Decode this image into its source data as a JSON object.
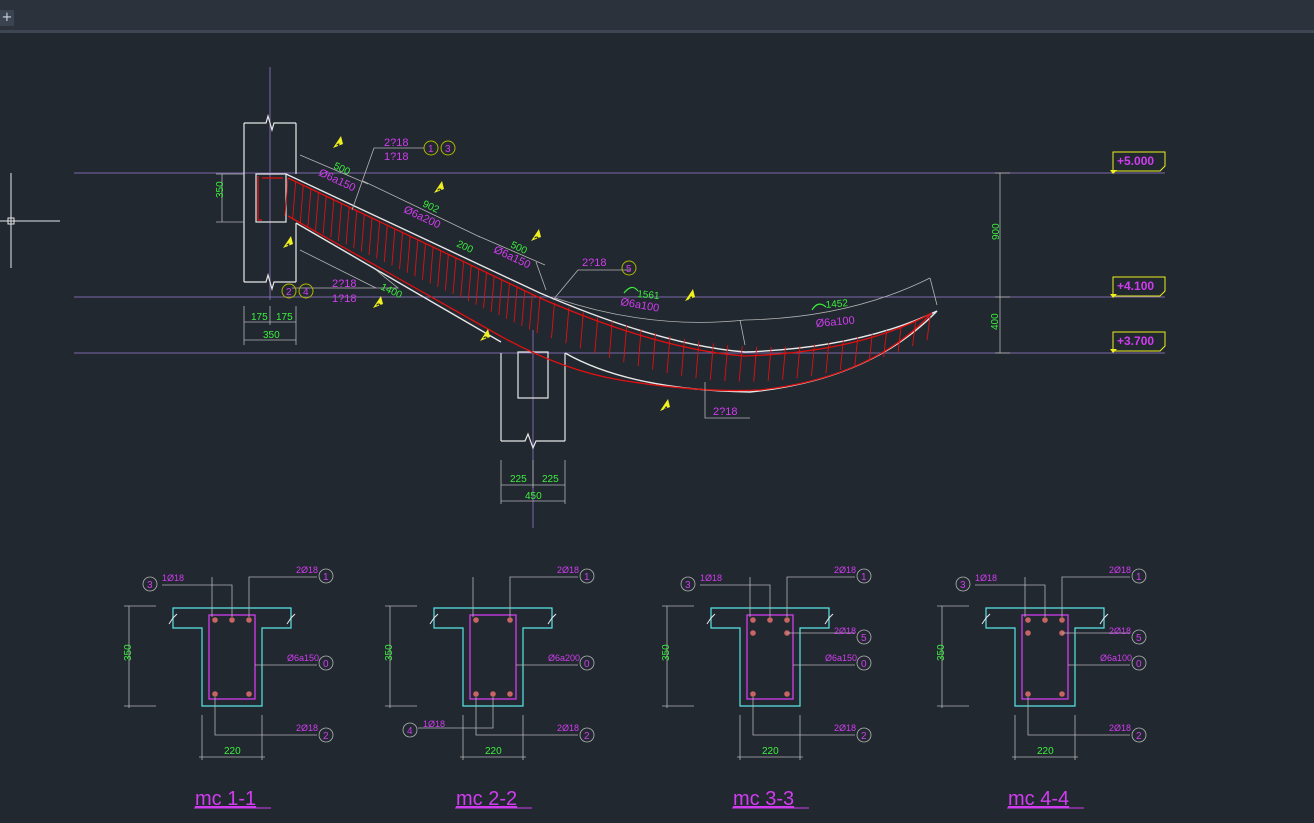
{
  "tabbar": {
    "add_label": "+"
  },
  "elevations": {
    "e1": "+5.000",
    "e2": "+4.100",
    "e3": "+3.700"
  },
  "dims": {
    "d350_left": "350",
    "d175a": "175",
    "d175b": "175",
    "d350_bottom": "350",
    "d900": "900",
    "d400": "400",
    "d225a": "225",
    "d225b": "225",
    "d450": "450",
    "d500a": "500",
    "d902": "902",
    "d200": "200",
    "d500b": "500",
    "d1400": "1400",
    "d1561": "1561",
    "d1452": "1452"
  },
  "rebar": {
    "top_a": "2?18",
    "top_b": "1?18",
    "bot_a": "2?18",
    "bot_b": "1?18",
    "mid": "2?18",
    "bottom_curve": "2?18",
    "stir1": "Ø6a150",
    "stir2": "Ø6a200",
    "stir3": "Ø6a150",
    "stir4": "Ø6a100",
    "stir5": "Ø6a100"
  },
  "markers": {
    "m1": "1",
    "m3": "3",
    "m2": "2",
    "m4": "4",
    "m5": "5"
  },
  "cut_marks": {
    "c1a": "1",
    "c1b": "1",
    "c2a": "2",
    "c2b": "2",
    "c3a": "3",
    "c3b": "3",
    "c4a": "4",
    "c4b": "4"
  },
  "sections": [
    {
      "title": "mc 1-1",
      "top_label": "2Ø18",
      "top_no": "1",
      "left_label": "1Ø18",
      "left_no": "3",
      "stir_label": "Ø6a150",
      "stir_no": "0",
      "bot_label": "2Ø18",
      "bot_no": "2",
      "height": "350",
      "width": "220"
    },
    {
      "title": "mc 2-2",
      "top_label": "2Ø18",
      "top_no": "1",
      "left_label": "1Ø18",
      "left_no": "4",
      "stir_label": "Ø6a200",
      "stir_no": "0",
      "bot_label": "2Ø18",
      "bot_no": "2",
      "height": "350",
      "width": "220"
    },
    {
      "title": "mc 3-3",
      "top_label": "2Ø18",
      "top_no": "1",
      "left_label": "1Ø18",
      "left_no": "3",
      "mid_label": "2Ø18",
      "mid_no": "5",
      "stir_label": "Ø6a150",
      "stir_no": "0",
      "bot_label": "2Ø18",
      "bot_no": "2",
      "height": "350",
      "width": "220"
    },
    {
      "title": "mc 4-4",
      "top_label": "2Ø18",
      "top_no": "1",
      "left_label": "1Ø18",
      "left_no": "3",
      "mid_label": "2Ø18",
      "mid_no": "5",
      "stir_label": "Ø6a100",
      "stir_no": "0",
      "bot_label": "2Ø18",
      "bot_no": "2",
      "height": "350",
      "width": "220"
    }
  ],
  "colors": {
    "bg": "#212830",
    "white": "#e8e8e8",
    "red": "#e01010",
    "green": "#3cf03c",
    "magenta": "#d23cf0",
    "yellow": "#f0f01e",
    "grid": "#7a6aa8",
    "gray": "#b4b4b4",
    "cyan": "#5ae6e6"
  }
}
